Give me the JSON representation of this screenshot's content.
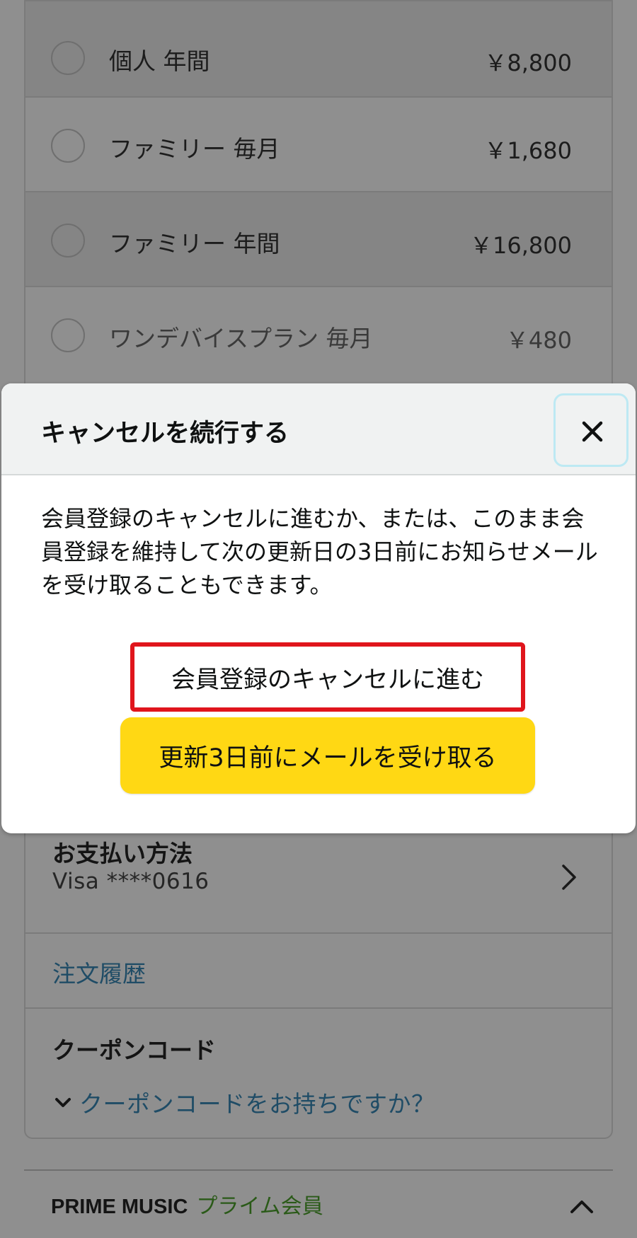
{
  "plans": [
    {
      "name": "個人 年間",
      "price": "￥8,800"
    },
    {
      "name": "ファミリー 毎月",
      "price": "￥1,680"
    },
    {
      "name": "ファミリー 年間",
      "price": "￥16,800"
    },
    {
      "name": "ワンデバイスプラン 毎月",
      "price": "￥480"
    }
  ],
  "modal": {
    "title": "キャンセルを続行する",
    "body": "会員登録のキャンセルに進むか、または、このまま会員登録を維持して次の更新日の3日前にお知らせメールを受け取ることもできます。",
    "proceed_label": "会員登録のキャンセルに進む",
    "notify_label": "更新3日前にメールを受け取る",
    "close_icon": "close-icon"
  },
  "payment": {
    "title": "お支払い方法",
    "value": "Visa  ****0616"
  },
  "order_history": "注文履歴",
  "coupon": {
    "title": "クーポンコード",
    "link": "クーポンコードをお持ちですか？"
  },
  "footer": {
    "brand": "PRIME MUSIC",
    "subtitle": "プライム会員"
  },
  "colors": {
    "highlight_border": "#e0151c",
    "primary_button": "#ffd814",
    "link": "#1f4c66",
    "overlay": "#8f8f8f"
  }
}
